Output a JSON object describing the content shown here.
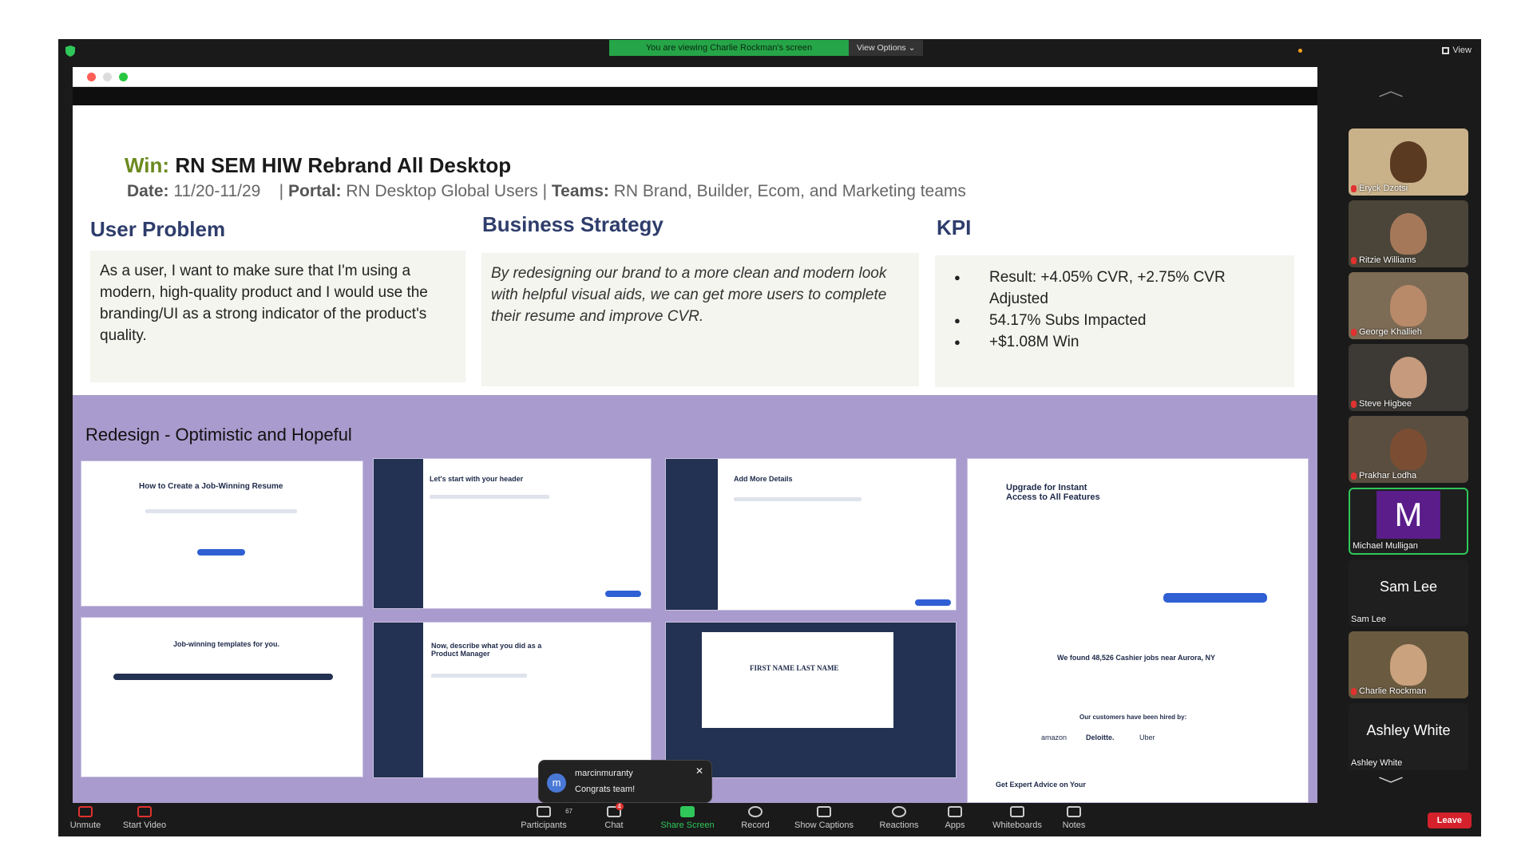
{
  "banner": {
    "viewing": "You are viewing Charlie Rockman's screen",
    "view_options": "View Options"
  },
  "view_label": "View",
  "slide": {
    "title_win": "Win:",
    "title_rest": "RN SEM HIW Rebrand All Desktop",
    "date_label": "Date:",
    "date_value": "11/20-11/29",
    "portal_label": "Portal:",
    "portal_value": "RN Desktop Global Users",
    "teams_label": "Teams:",
    "teams_value": "RN Brand, Builder, Ecom, and Marketing teams",
    "user_problem_heading": "User Problem",
    "user_problem_text": "As a user, I want to make sure that I'm using a modern, high-quality product and I would use the branding/UI as a strong indicator of the product's quality.",
    "strategy_heading": "Business Strategy",
    "strategy_text": "By redesigning our brand to a more clean and modern look with helpful visual aids, we can get more users to complete their resume and improve CVR.",
    "kpi_heading": "KPI",
    "kpi_items": [
      "Result: +4.05% CVR, +2.75% CVR Adjusted",
      "54.17% Subs Impacted",
      "+$1.08M Win"
    ],
    "redesign_heading": "Redesign - Optimistic and Hopeful",
    "thumbs": [
      "How to Create a Job-Winning Resume",
      "Let's start with your header",
      "Add More Details",
      "Upgrade for Instant Access to All Features",
      "Job-winning templates for you.",
      "Now, describe what you did as a Product Manager",
      "FIRST NAME LAST NAME",
      "We found 48,526 Cashier jobs near Aurora, NY"
    ],
    "thumb_extra": {
      "customers": "Our customers have been hired by:",
      "brands": [
        "amazon",
        "Deloitte.",
        "Uber"
      ],
      "advice": "Get Expert Advice on Your"
    }
  },
  "chat_toast": {
    "initial": "m",
    "name": "marcinmuranty",
    "message": "Congrats team!"
  },
  "participants": [
    {
      "name": "Eryck Dzotsi",
      "type": "video",
      "muted": true
    },
    {
      "name": "Ritzie Williams",
      "type": "video",
      "muted": true
    },
    {
      "name": "George Khallieh",
      "type": "video",
      "muted": true
    },
    {
      "name": "Steve Higbee",
      "type": "video",
      "muted": true
    },
    {
      "name": "Prakhar Lodha",
      "type": "video",
      "muted": true
    },
    {
      "name": "Michael Mulligan",
      "type": "initial",
      "initial": "M",
      "active": true
    },
    {
      "name": "Sam Lee",
      "type": "name"
    },
    {
      "name": "Charlie Rockman",
      "type": "video",
      "muted": true
    },
    {
      "name": "Ashley White",
      "type": "name"
    }
  ],
  "toolbar": {
    "unmute": "Unmute",
    "start_video": "Start Video",
    "participants": "Participants",
    "participant_count": "67",
    "chat": "Chat",
    "chat_badge": "4",
    "share_screen": "Share Screen",
    "record": "Record",
    "show_captions": "Show Captions",
    "reactions": "Reactions",
    "apps": "Apps",
    "whiteboards": "Whiteboards",
    "notes": "Notes",
    "leave": "Leave"
  },
  "colors": {
    "win_green": "#6b8a1f",
    "heading_navy": "#2e3d6b",
    "band_purple": "#a99bcd",
    "share_green": "#25a547",
    "leave_red": "#d4212b"
  }
}
